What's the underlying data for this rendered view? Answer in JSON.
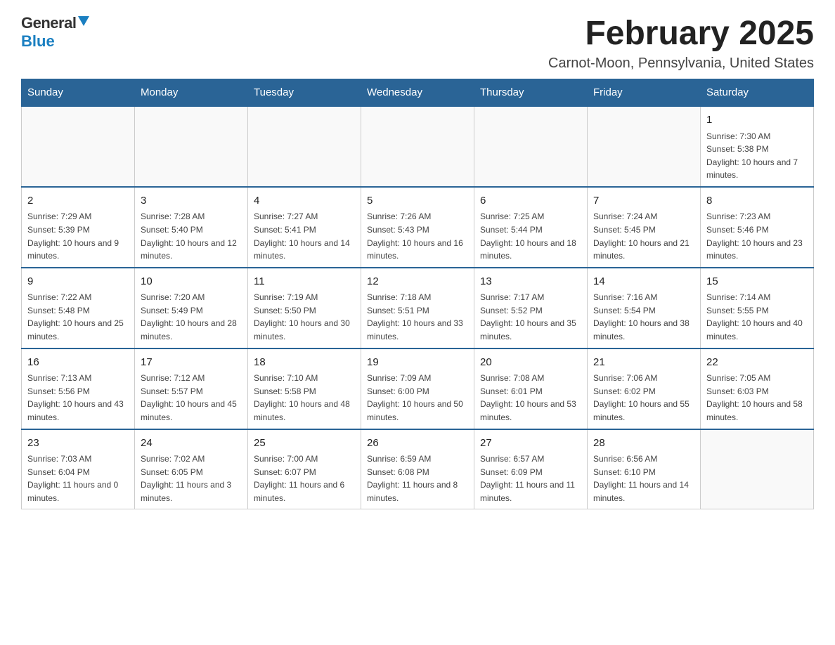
{
  "logo": {
    "general": "General",
    "blue": "Blue"
  },
  "title": {
    "month_year": "February 2025",
    "location": "Carnot-Moon, Pennsylvania, United States"
  },
  "weekdays": [
    "Sunday",
    "Monday",
    "Tuesday",
    "Wednesday",
    "Thursday",
    "Friday",
    "Saturday"
  ],
  "weeks": [
    [
      {
        "day": "",
        "info": ""
      },
      {
        "day": "",
        "info": ""
      },
      {
        "day": "",
        "info": ""
      },
      {
        "day": "",
        "info": ""
      },
      {
        "day": "",
        "info": ""
      },
      {
        "day": "",
        "info": ""
      },
      {
        "day": "1",
        "info": "Sunrise: 7:30 AM\nSunset: 5:38 PM\nDaylight: 10 hours and 7 minutes."
      }
    ],
    [
      {
        "day": "2",
        "info": "Sunrise: 7:29 AM\nSunset: 5:39 PM\nDaylight: 10 hours and 9 minutes."
      },
      {
        "day": "3",
        "info": "Sunrise: 7:28 AM\nSunset: 5:40 PM\nDaylight: 10 hours and 12 minutes."
      },
      {
        "day": "4",
        "info": "Sunrise: 7:27 AM\nSunset: 5:41 PM\nDaylight: 10 hours and 14 minutes."
      },
      {
        "day": "5",
        "info": "Sunrise: 7:26 AM\nSunset: 5:43 PM\nDaylight: 10 hours and 16 minutes."
      },
      {
        "day": "6",
        "info": "Sunrise: 7:25 AM\nSunset: 5:44 PM\nDaylight: 10 hours and 18 minutes."
      },
      {
        "day": "7",
        "info": "Sunrise: 7:24 AM\nSunset: 5:45 PM\nDaylight: 10 hours and 21 minutes."
      },
      {
        "day": "8",
        "info": "Sunrise: 7:23 AM\nSunset: 5:46 PM\nDaylight: 10 hours and 23 minutes."
      }
    ],
    [
      {
        "day": "9",
        "info": "Sunrise: 7:22 AM\nSunset: 5:48 PM\nDaylight: 10 hours and 25 minutes."
      },
      {
        "day": "10",
        "info": "Sunrise: 7:20 AM\nSunset: 5:49 PM\nDaylight: 10 hours and 28 minutes."
      },
      {
        "day": "11",
        "info": "Sunrise: 7:19 AM\nSunset: 5:50 PM\nDaylight: 10 hours and 30 minutes."
      },
      {
        "day": "12",
        "info": "Sunrise: 7:18 AM\nSunset: 5:51 PM\nDaylight: 10 hours and 33 minutes."
      },
      {
        "day": "13",
        "info": "Sunrise: 7:17 AM\nSunset: 5:52 PM\nDaylight: 10 hours and 35 minutes."
      },
      {
        "day": "14",
        "info": "Sunrise: 7:16 AM\nSunset: 5:54 PM\nDaylight: 10 hours and 38 minutes."
      },
      {
        "day": "15",
        "info": "Sunrise: 7:14 AM\nSunset: 5:55 PM\nDaylight: 10 hours and 40 minutes."
      }
    ],
    [
      {
        "day": "16",
        "info": "Sunrise: 7:13 AM\nSunset: 5:56 PM\nDaylight: 10 hours and 43 minutes."
      },
      {
        "day": "17",
        "info": "Sunrise: 7:12 AM\nSunset: 5:57 PM\nDaylight: 10 hours and 45 minutes."
      },
      {
        "day": "18",
        "info": "Sunrise: 7:10 AM\nSunset: 5:58 PM\nDaylight: 10 hours and 48 minutes."
      },
      {
        "day": "19",
        "info": "Sunrise: 7:09 AM\nSunset: 6:00 PM\nDaylight: 10 hours and 50 minutes."
      },
      {
        "day": "20",
        "info": "Sunrise: 7:08 AM\nSunset: 6:01 PM\nDaylight: 10 hours and 53 minutes."
      },
      {
        "day": "21",
        "info": "Sunrise: 7:06 AM\nSunset: 6:02 PM\nDaylight: 10 hours and 55 minutes."
      },
      {
        "day": "22",
        "info": "Sunrise: 7:05 AM\nSunset: 6:03 PM\nDaylight: 10 hours and 58 minutes."
      }
    ],
    [
      {
        "day": "23",
        "info": "Sunrise: 7:03 AM\nSunset: 6:04 PM\nDaylight: 11 hours and 0 minutes."
      },
      {
        "day": "24",
        "info": "Sunrise: 7:02 AM\nSunset: 6:05 PM\nDaylight: 11 hours and 3 minutes."
      },
      {
        "day": "25",
        "info": "Sunrise: 7:00 AM\nSunset: 6:07 PM\nDaylight: 11 hours and 6 minutes."
      },
      {
        "day": "26",
        "info": "Sunrise: 6:59 AM\nSunset: 6:08 PM\nDaylight: 11 hours and 8 minutes."
      },
      {
        "day": "27",
        "info": "Sunrise: 6:57 AM\nSunset: 6:09 PM\nDaylight: 11 hours and 11 minutes."
      },
      {
        "day": "28",
        "info": "Sunrise: 6:56 AM\nSunset: 6:10 PM\nDaylight: 11 hours and 14 minutes."
      },
      {
        "day": "",
        "info": ""
      }
    ]
  ]
}
